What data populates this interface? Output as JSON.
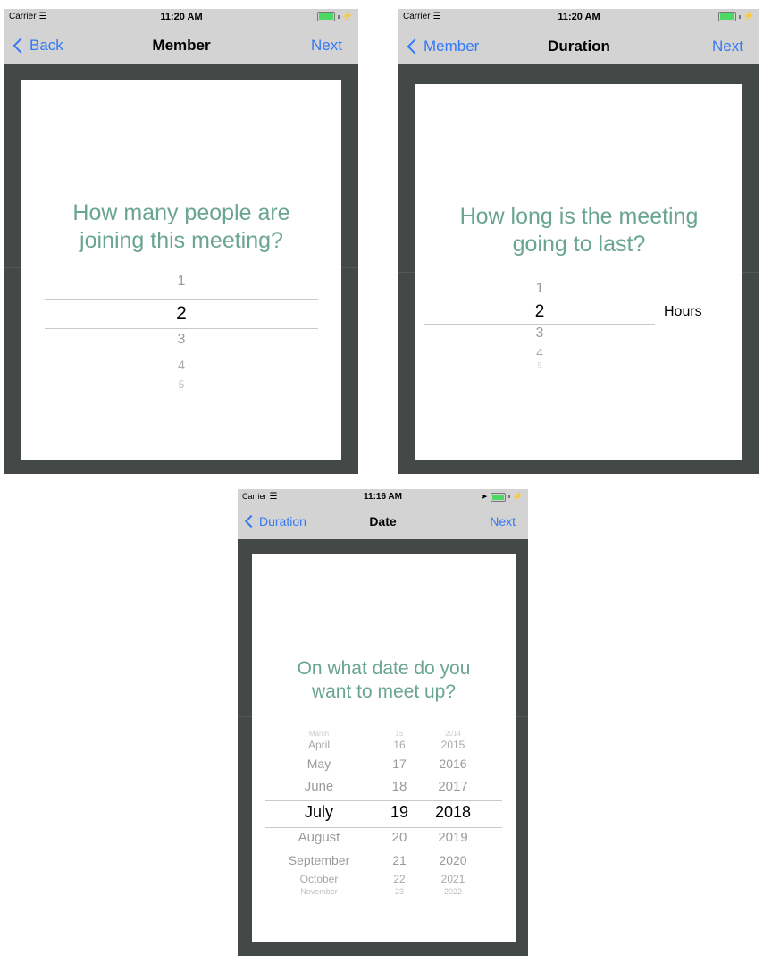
{
  "screens": [
    {
      "status": {
        "carrier": "Carrier",
        "time": "11:20 AM"
      },
      "nav": {
        "back": "Back",
        "title": "Member",
        "next": "Next"
      },
      "question": "How many people are joining this meeting?",
      "picker": {
        "above": [
          "1"
        ],
        "selected": "2",
        "below": [
          "3",
          "4",
          "5"
        ]
      }
    },
    {
      "status": {
        "carrier": "Carrier",
        "time": "11:20 AM"
      },
      "nav": {
        "back": "Member",
        "title": "Duration",
        "next": "Next"
      },
      "question": "How long is the meeting going to last?",
      "picker": {
        "above": [
          "1"
        ],
        "selected": "2",
        "below": [
          "3",
          "4",
          "5"
        ],
        "unit": "Hours"
      }
    },
    {
      "status": {
        "carrier": "Carrier",
        "time": "11:16 AM"
      },
      "nav": {
        "back": "Duration",
        "title": "Date",
        "next": "Next"
      },
      "question": "On what date do you want to meet up?",
      "date_picker": {
        "months": [
          "March",
          "April",
          "May",
          "June",
          "July",
          "August",
          "September",
          "October",
          "November"
        ],
        "days": [
          "15",
          "16",
          "17",
          "18",
          "19",
          "20",
          "21",
          "22",
          "23"
        ],
        "years": [
          "2014",
          "2015",
          "2016",
          "2017",
          "2018",
          "2019",
          "2020",
          "2021",
          "2022"
        ],
        "selected": {
          "month": "July",
          "day": "19",
          "year": "2018"
        }
      }
    }
  ],
  "colors": {
    "accent": "#3478f6",
    "question": "#6aa58f",
    "frame": "#444948",
    "bar": "#d3d3d3",
    "battery": "#4cd964"
  },
  "icons": [
    "wifi-icon",
    "battery-icon",
    "charging-bolt-icon",
    "location-arrow-icon",
    "chevron-left-icon"
  ]
}
